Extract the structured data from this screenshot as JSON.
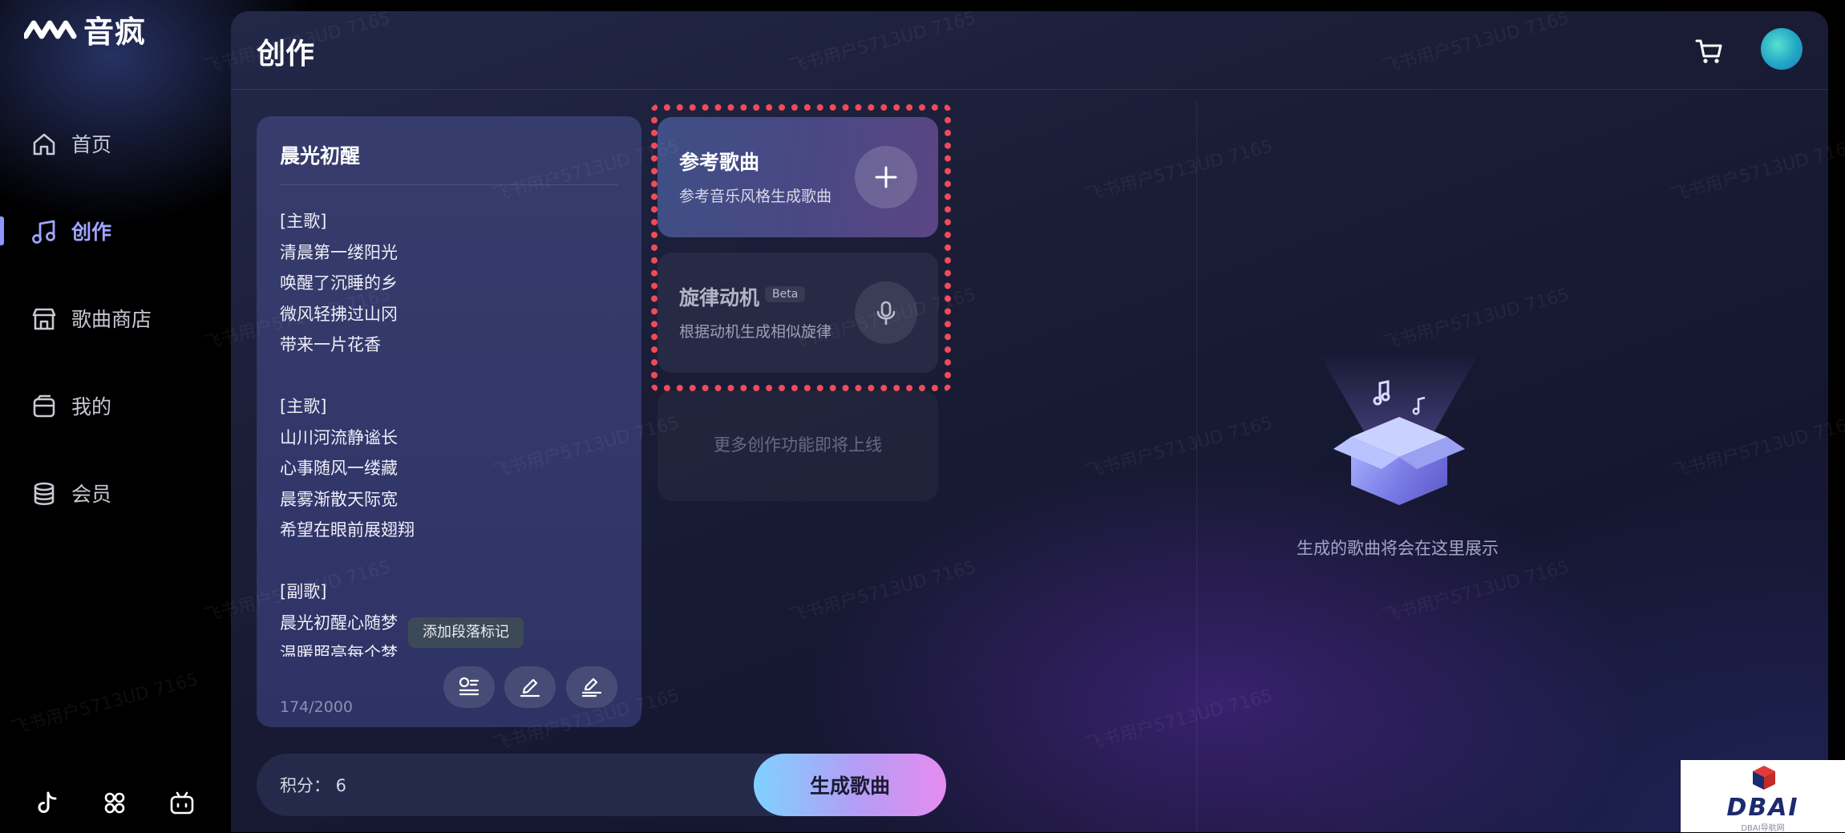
{
  "app": {
    "name": "音疯"
  },
  "sidebar": {
    "items": [
      {
        "label": "首页",
        "icon": "home-icon"
      },
      {
        "label": "创作",
        "icon": "music-note-icon",
        "active": true
      },
      {
        "label": "歌曲商店",
        "icon": "store-icon"
      },
      {
        "label": "我的",
        "icon": "wallet-icon"
      },
      {
        "label": "会员",
        "icon": "database-icon"
      }
    ],
    "bottom_icons": [
      "tiktok-icon",
      "community-icon",
      "bilibili-icon"
    ]
  },
  "header": {
    "title": "创作",
    "cart_icon": "cart-icon",
    "avatar": "avatar"
  },
  "lyrics": {
    "title": "晨光初醒",
    "lines": [
      "[主歌]",
      "清晨第一缕阳光",
      "唤醒了沉睡的乡",
      "微风轻拂过山冈",
      "带来一片花香",
      "",
      "[主歌]",
      "山川河流静谧长",
      "心事随风一缕藏",
      "晨雾渐散天际宽",
      "希望在眼前展翅翔",
      "",
      "[副歌]",
      "晨光初醒心随梦",
      "温暖照亮每个梦"
    ],
    "counter": "174/2000",
    "tooltip": "添加段落标记",
    "tools": [
      "paragraph-mark-icon",
      "pen-icon",
      "rewrite-icon"
    ]
  },
  "features": {
    "reference": {
      "title": "参考歌曲",
      "subtitle": "参考音乐风格生成歌曲"
    },
    "melody": {
      "title": "旋律动机",
      "badge": "Beta",
      "subtitle": "根据动机生成相似旋律"
    },
    "more": "更多创作功能即将上线"
  },
  "empty_state": {
    "text": "生成的歌曲将会在这里展示"
  },
  "footer": {
    "points_label": "积分：  6",
    "generate_button": "生成歌曲"
  },
  "watermark": "飞书用户5713UD 7165",
  "badge": {
    "title": "DBAI",
    "subtitle": "DBAI导航网"
  },
  "colors": {
    "accent": "#9fa6ff",
    "highlight_frame": "#f04b5a",
    "generate_gradient_start": "#7fd1ff",
    "generate_gradient_end": "#e58cf0"
  }
}
